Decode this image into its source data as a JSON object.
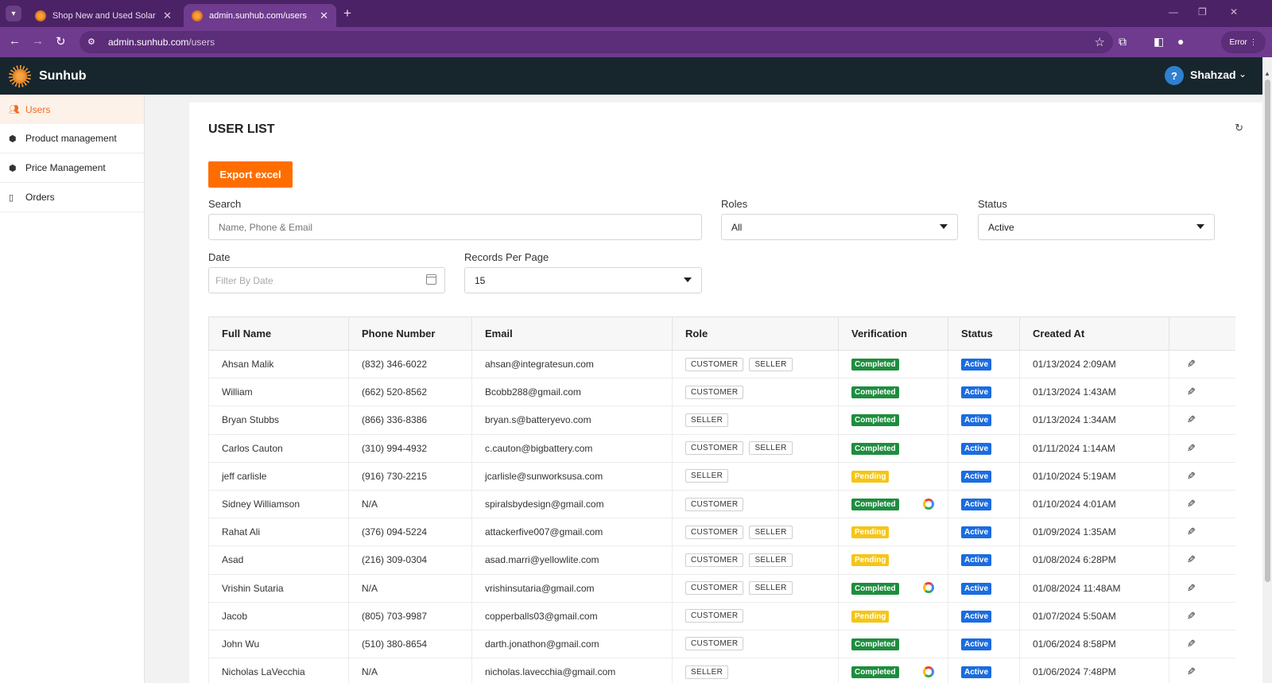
{
  "browser": {
    "tabs": [
      {
        "title": "Shop New and Used Solar Panels",
        "active": false
      },
      {
        "title": "admin.sunhub.com/users",
        "active": true
      }
    ],
    "url_host": "admin.sunhub.com",
    "url_path": "/users",
    "profile_status": "Error"
  },
  "header": {
    "brand": "Sunhub",
    "help_glyph": "?",
    "user_name": "Shahzad"
  },
  "sidebar": {
    "items": [
      {
        "label": "Users",
        "icon": "users-icon",
        "active": true
      },
      {
        "label": "Product management",
        "icon": "cubes-icon",
        "active": false
      },
      {
        "label": "Price Management",
        "icon": "cubes-icon",
        "active": false
      },
      {
        "label": "Orders",
        "icon": "clipboard-icon",
        "active": false
      }
    ]
  },
  "page": {
    "title": "USER LIST",
    "export_label": "Export excel",
    "filters": {
      "search_label": "Search",
      "search_placeholder": "Name, Phone & Email",
      "roles_label": "Roles",
      "roles_value": "All",
      "status_label": "Status",
      "status_value": "Active",
      "date_label": "Date",
      "date_placeholder": "Filter By Date",
      "records_label": "Records Per Page",
      "records_value": "15"
    }
  },
  "table": {
    "columns": [
      "Full Name",
      "Phone Number",
      "Email",
      "Role",
      "Verification",
      "Status",
      "Created At",
      ""
    ],
    "rows": [
      {
        "name": "Ahsan Malik",
        "phone": "(832) 346-6022",
        "email": "ahsan@integratesun.com",
        "roles": [
          "CUSTOMER",
          "SELLER"
        ],
        "verification": "Completed",
        "google": false,
        "status": "Active",
        "created": "01/13/2024 2:09AM"
      },
      {
        "name": "William",
        "phone": "(662) 520-8562",
        "email": "Bcobb288@gmail.com",
        "roles": [
          "CUSTOMER"
        ],
        "verification": "Completed",
        "google": false,
        "status": "Active",
        "created": "01/13/2024 1:43AM"
      },
      {
        "name": "Bryan Stubbs",
        "phone": "(866) 336-8386",
        "email": "bryan.s@batteryevo.com",
        "roles": [
          "SELLER"
        ],
        "verification": "Completed",
        "google": false,
        "status": "Active",
        "created": "01/13/2024 1:34AM"
      },
      {
        "name": "Carlos Cauton",
        "phone": "(310) 994-4932",
        "email": "c.cauton@bigbattery.com",
        "roles": [
          "CUSTOMER",
          "SELLER"
        ],
        "verification": "Completed",
        "google": false,
        "status": "Active",
        "created": "01/11/2024 1:14AM"
      },
      {
        "name": "jeff carlisle",
        "phone": "(916) 730-2215",
        "email": "jcarlisle@sunworksusa.com",
        "roles": [
          "SELLER"
        ],
        "verification": "Pending",
        "google": false,
        "status": "Active",
        "created": "01/10/2024 5:19AM"
      },
      {
        "name": "Sidney Williamson",
        "phone": "N/A",
        "email": "spiralsbydesign@gmail.com",
        "roles": [
          "CUSTOMER"
        ],
        "verification": "Completed",
        "google": true,
        "status": "Active",
        "created": "01/10/2024 4:01AM"
      },
      {
        "name": "Rahat Ali",
        "phone": "(376) 094-5224",
        "email": "attackerfive007@gmail.com",
        "roles": [
          "CUSTOMER",
          "SELLER"
        ],
        "verification": "Pending",
        "google": false,
        "status": "Active",
        "created": "01/09/2024 1:35AM"
      },
      {
        "name": "Asad",
        "phone": "(216) 309-0304",
        "email": "asad.marri@yellowlite.com",
        "roles": [
          "CUSTOMER",
          "SELLER"
        ],
        "verification": "Pending",
        "google": false,
        "status": "Active",
        "created": "01/08/2024 6:28PM"
      },
      {
        "name": "Vrishin Sutaria",
        "phone": "N/A",
        "email": "vrishinsutaria@gmail.com",
        "roles": [
          "CUSTOMER",
          "SELLER"
        ],
        "verification": "Completed",
        "google": true,
        "status": "Active",
        "created": "01/08/2024 11:48AM"
      },
      {
        "name": "Jacob",
        "phone": "(805) 703-9987",
        "email": "copperballs03@gmail.com",
        "roles": [
          "CUSTOMER"
        ],
        "verification": "Pending",
        "google": false,
        "status": "Active",
        "created": "01/07/2024 5:50AM"
      },
      {
        "name": "John Wu",
        "phone": "(510) 380-8654",
        "email": "darth.jonathon@gmail.com",
        "roles": [
          "CUSTOMER"
        ],
        "verification": "Completed",
        "google": false,
        "status": "Active",
        "created": "01/06/2024 8:58PM"
      },
      {
        "name": "Nicholas LaVecchia",
        "phone": "N/A",
        "email": "nicholas.lavecchia@gmail.com",
        "roles": [
          "SELLER"
        ],
        "verification": "Completed",
        "google": true,
        "status": "Active",
        "created": "01/06/2024 7:48PM"
      }
    ]
  },
  "colors": {
    "accent_orange": "#ff6d00",
    "browser_purple": "#6f3b8e",
    "header_dark": "#17262d",
    "badge_completed": "#1e8d3e",
    "badge_pending": "#f5c518",
    "badge_active": "#1a6ce0"
  }
}
